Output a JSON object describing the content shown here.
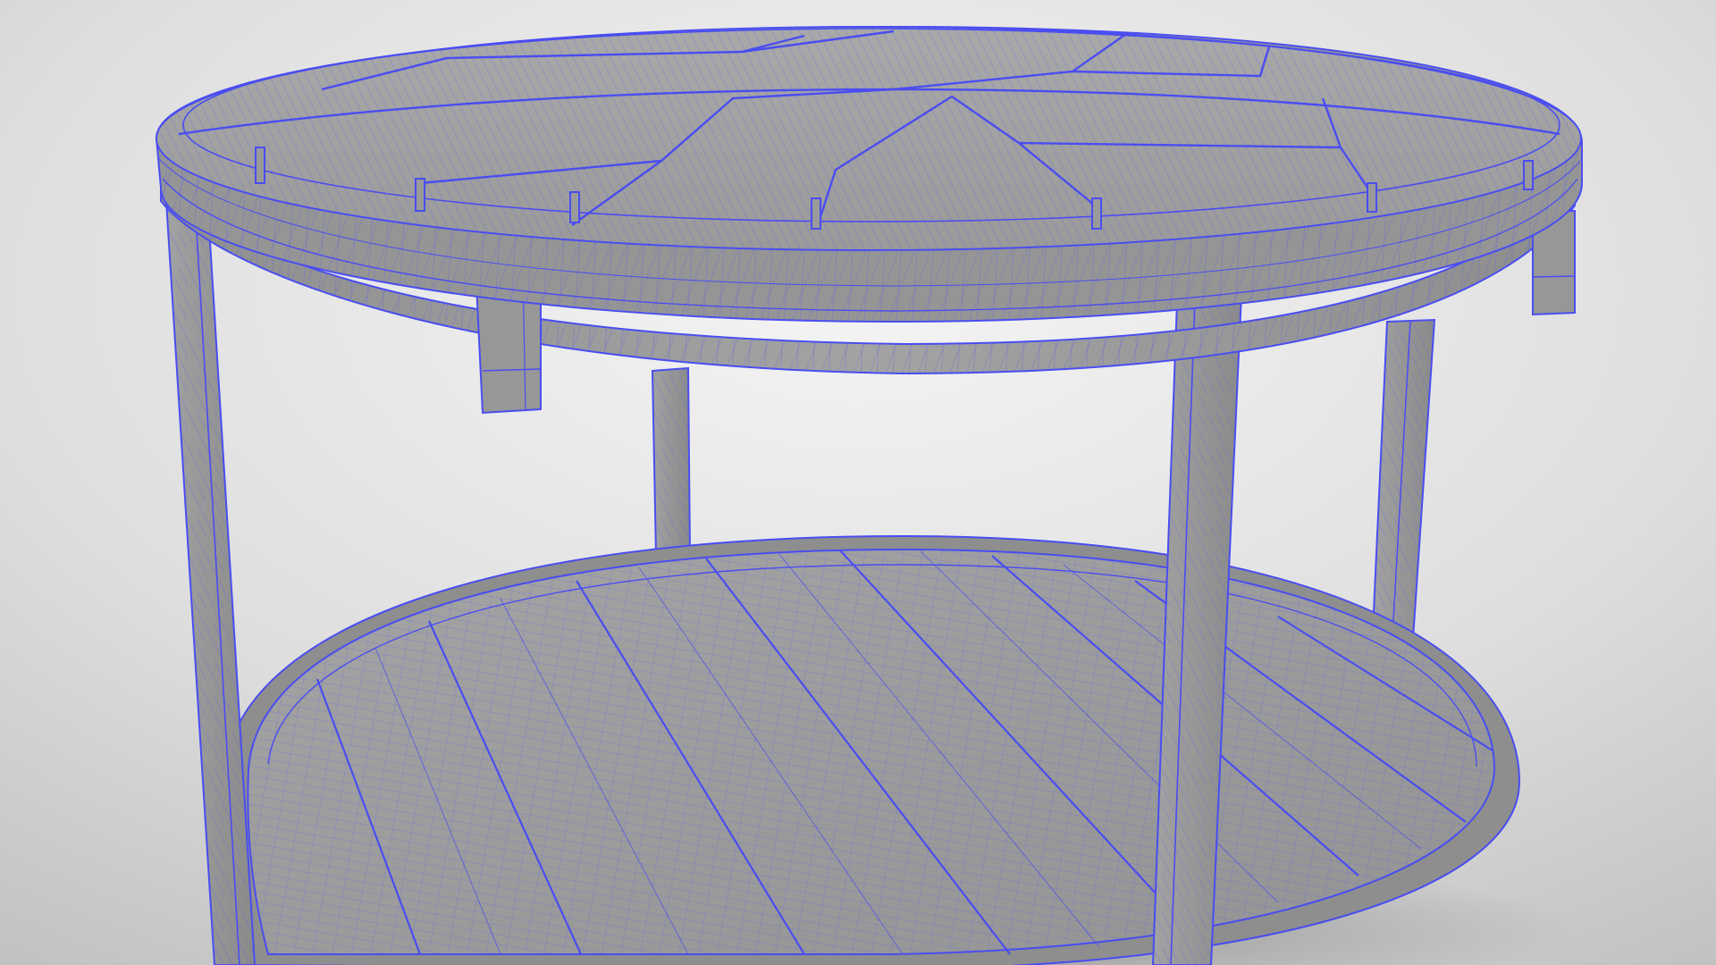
{
  "scene": {
    "subject": "round-coffee-table",
    "render_style": "wireframe-on-shaded",
    "colors": {
      "background_light": "#f2f2f2",
      "background_dark": "#c4c4c4",
      "surface": "#9c9c9c",
      "surface_light": "#ababab",
      "surface_dark": "#8a8a8a",
      "wire": "#4a4df0",
      "shadow": "#6e6e6e"
    },
    "components": {
      "tabletop_planks": 7,
      "apron_blocks": 4,
      "legs": 4,
      "shelf_planks": 9
    }
  }
}
